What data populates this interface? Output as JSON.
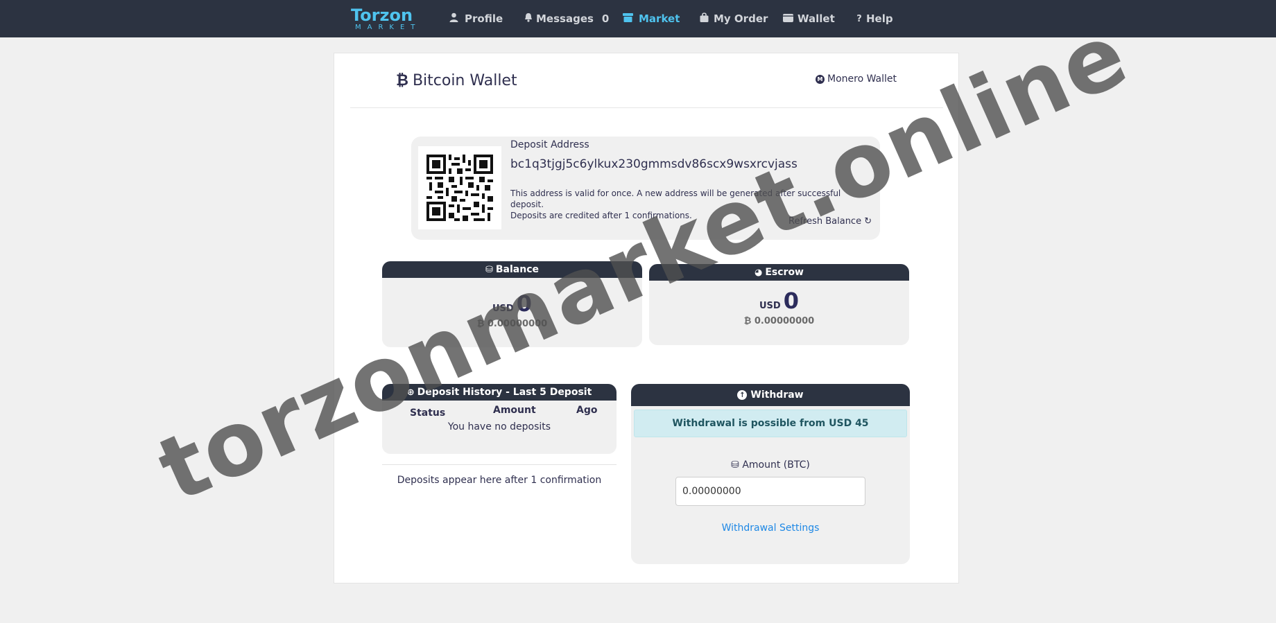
{
  "nav": {
    "logo_text": "Torzon",
    "logo_sub": "MARKET",
    "items": [
      {
        "label": "Profile",
        "icon": "user-icon"
      },
      {
        "label": "Messages",
        "icon": "bell-icon",
        "count": "0"
      },
      {
        "label": "Market",
        "icon": "store-icon"
      },
      {
        "label": "My Order",
        "icon": "bag-icon"
      },
      {
        "label": "Wallet",
        "icon": "wallet-icon"
      },
      {
        "label": "Help",
        "icon": "question-icon"
      }
    ],
    "active_color": "#4fc3ee",
    "bg_color": "#2c3341"
  },
  "wallet": {
    "title": "Bitcoin Wallet",
    "title_icon": "bitcoin-icon",
    "monero_link": "Monero Wallet",
    "monero_icon": "monero-icon"
  },
  "deposit": {
    "label": "Deposit Address",
    "address": "bc1q3tjgj5c6ylkux230gmmsdv86scx9wsxrcvjass",
    "note_line1": "This address is valid for once. A new address will be generated after successful deposit.",
    "note_line2": "Deposits are credited after 1 confirmations.",
    "refresh_label": "Refresh Balance ↻"
  },
  "balance": {
    "title": "Balance",
    "currency": "USD",
    "usd": "0",
    "btc": "0.00000000"
  },
  "escrow": {
    "title": "Escrow",
    "currency": "USD",
    "usd": "0",
    "btc": "0.00000000"
  },
  "history": {
    "title": "Deposit History - Last 5 Deposit",
    "columns": [
      "Status",
      "Amount",
      "Ago"
    ],
    "empty": "You have no deposits",
    "note": "Deposits appear here after 1 confirmation"
  },
  "withdraw": {
    "title": "Withdraw",
    "alert": "Withdrawal is possible from USD 45",
    "amount_label": "Amount (BTC)",
    "amount_value": "0.00000000",
    "settings_link": "Withdrawal Settings"
  },
  "watermark": "torzonmarket.online"
}
